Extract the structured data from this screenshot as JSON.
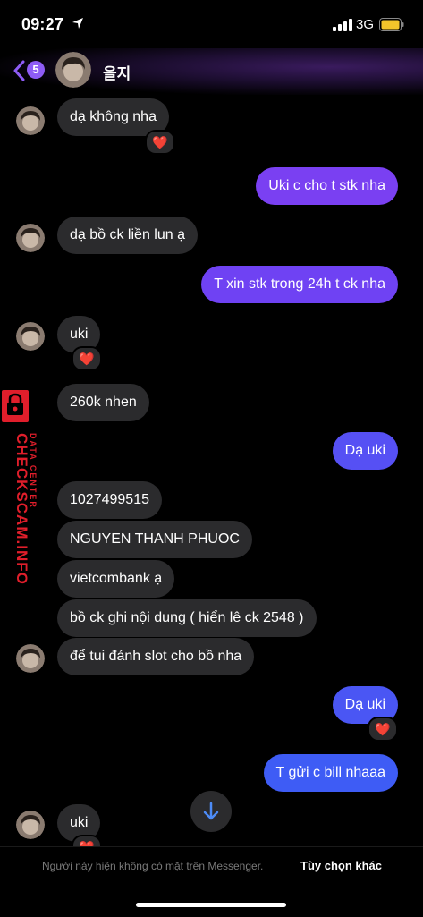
{
  "status": {
    "time": "09:27",
    "network": "3G"
  },
  "header": {
    "back_badge": "5",
    "contact_name": "을지"
  },
  "messages": [
    {
      "dir": "in",
      "text": "dạ không nha"
    },
    {
      "dir": "out",
      "text": "Uki c cho t stk nha"
    },
    {
      "dir": "in",
      "text": "dạ bồ ck liền lun ạ"
    },
    {
      "dir": "out",
      "text": "T xin stk trong 24h t ck nha"
    },
    {
      "dir": "in",
      "text": "uki"
    },
    {
      "dir": "in",
      "text": "260k nhen"
    },
    {
      "dir": "out",
      "text": "Dạ uki"
    },
    {
      "dir": "in",
      "text": "1027499515"
    },
    {
      "dir": "in",
      "text": "NGUYEN THANH PHUOC"
    },
    {
      "dir": "in",
      "text": "vietcombank ạ"
    },
    {
      "dir": "in",
      "text": "bồ ck ghi nội dung ( hiển lê ck 2548 )"
    },
    {
      "dir": "in",
      "text": "để tui đánh slot cho bồ nha"
    },
    {
      "dir": "out",
      "text": "Dạ uki"
    },
    {
      "dir": "out",
      "text": "T gửi c bill nhaaa"
    },
    {
      "dir": "in",
      "text": "uki"
    }
  ],
  "reactions": {
    "emoji": "❤️"
  },
  "footer": {
    "note": "Người này hiện không có mặt trên Messenger.",
    "options": "Tùy chọn khác"
  },
  "watermark": {
    "main": "CHECKSCAM.INFO",
    "sub": "DATA CENTER"
  },
  "colors": {
    "outgoing_top": "#7c3ff2",
    "outgoing_bottom": "#3d5cf5",
    "incoming": "#2b2b2d",
    "badge": "#8e5cf5"
  }
}
